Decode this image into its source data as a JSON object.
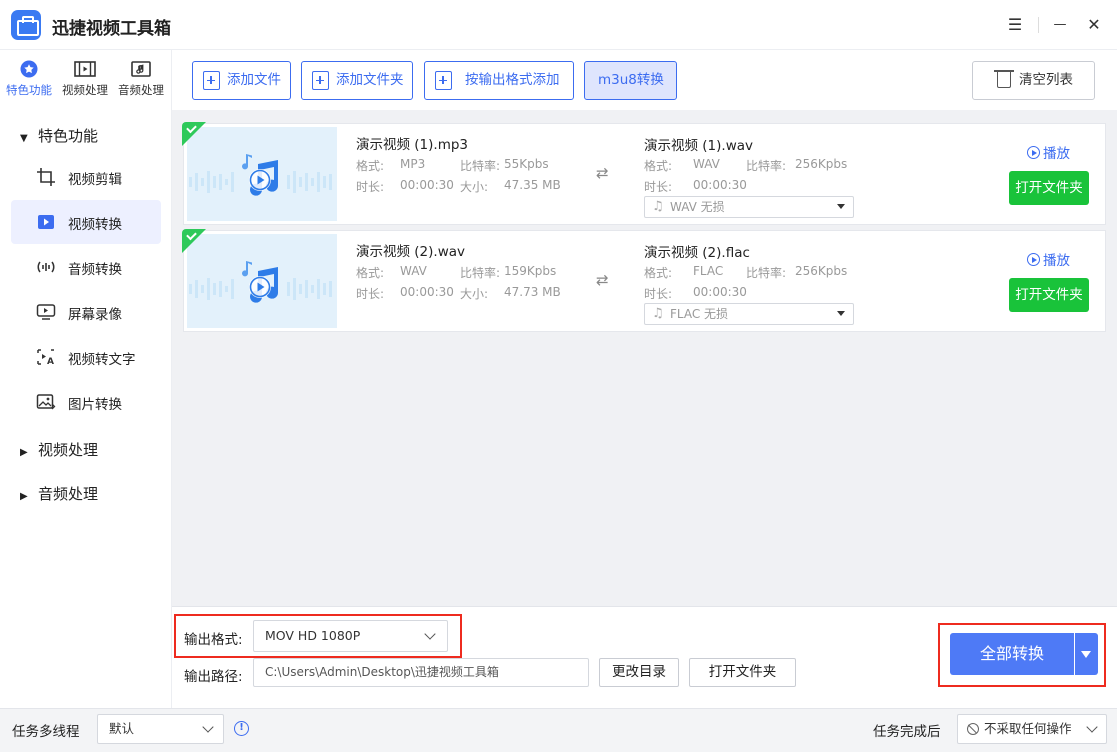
{
  "app": {
    "title": "迅捷视频工具箱"
  },
  "window_controls": {
    "menu": "☰",
    "minimize": "—",
    "close": "✕"
  },
  "categories": [
    {
      "label": "特色功能",
      "icon": "star-icon",
      "active": true
    },
    {
      "label": "视频处理",
      "icon": "film-icon",
      "active": false
    },
    {
      "label": "音频处理",
      "icon": "music-file-icon",
      "active": false
    }
  ],
  "tree": {
    "featured_group": "特色功能",
    "featured_items": [
      {
        "label": "视频剪辑",
        "icon": "crop-icon"
      },
      {
        "label": "视频转换",
        "icon": "video-play-icon",
        "active": true
      },
      {
        "label": "音频转换",
        "icon": "audio-wave-icon"
      },
      {
        "label": "屏幕录像",
        "icon": "screen-record-icon"
      },
      {
        "label": "视频转文字",
        "icon": "video-to-text-icon"
      },
      {
        "label": "图片转换",
        "icon": "image-icon"
      }
    ],
    "video_group": "视频处理",
    "audio_group": "音频处理"
  },
  "toolbar": {
    "add_file": "添加文件",
    "add_folder": "添加文件夹",
    "add_by_format": "按输出格式添加",
    "m3u8": "m3u8转换",
    "clear_list": "清空列表"
  },
  "labels": {
    "format": "格式:",
    "bitrate": "比特率:",
    "duration": "时长:",
    "size": "大小:",
    "play": "播放",
    "open_folder": "打开文件夹"
  },
  "files": [
    {
      "src_name": "演示视频 (1).mp3",
      "src_format": "MP3",
      "src_bitrate": "55Kpbs",
      "src_duration": "00:00:30",
      "src_size": "47.35 MB",
      "out_name": "演示视频 (1).wav",
      "out_format": "WAV",
      "out_bitrate": "256Kpbs",
      "out_duration": "00:00:30",
      "out_option": "WAV  无损"
    },
    {
      "src_name": "演示视频 (2).wav",
      "src_format": "WAV",
      "src_bitrate": "159Kpbs",
      "src_duration": "00:00:30",
      "src_size": "47.73 MB",
      "out_name": "演示视频 (2).flac",
      "out_format": "FLAC",
      "out_bitrate": "256Kpbs",
      "out_duration": "00:00:30",
      "out_option": "FLAC  无损"
    }
  ],
  "output": {
    "format_label": "输出格式:",
    "format_value": "MOV  HD 1080P",
    "path_label": "输出路径:",
    "path_value": "C:\\Users\\Admin\\Desktop\\迅捷视频工具箱",
    "change_dir": "更改目录",
    "open_folder": "打开文件夹",
    "convert_all": "全部转换"
  },
  "status": {
    "multithread_label": "任务多线程",
    "multithread_value": "默认",
    "after_label": "任务完成后",
    "after_value": "不采取任何操作"
  },
  "colors": {
    "accent": "#3c6cf0",
    "convert": "#4e7af6",
    "open_folder": "#19c33a",
    "done_check": "#2ec95a",
    "highlight_box": "#ee2b1f"
  }
}
